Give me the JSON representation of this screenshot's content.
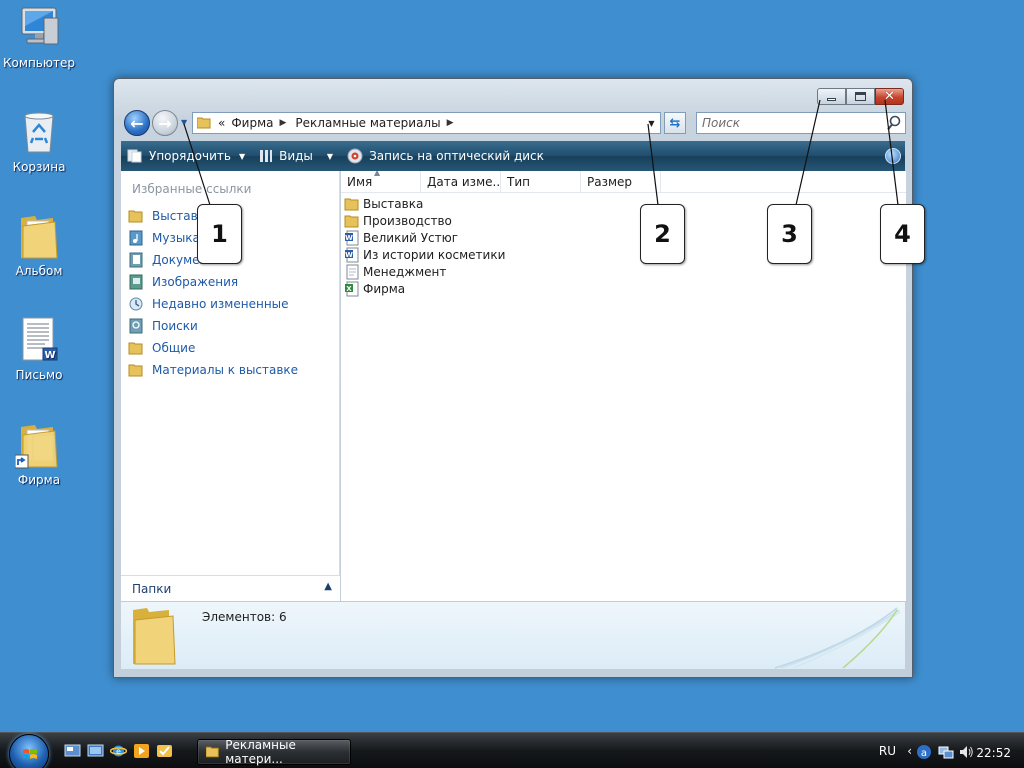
{
  "desktop": {
    "icons": [
      {
        "label": "Компьютер",
        "icon": "computer-icon"
      },
      {
        "label": "Корзина",
        "icon": "recycle-bin-icon"
      },
      {
        "label": "Альбом",
        "icon": "folder-icon"
      },
      {
        "label": "Письмо",
        "icon": "word-document-icon"
      },
      {
        "label": "Фирма",
        "icon": "folder-shortcut-icon"
      }
    ]
  },
  "window": {
    "address": {
      "prefix": "«",
      "segments": [
        "Фирма",
        "Рекламные материалы"
      ]
    },
    "search": {
      "placeholder": "Поиск"
    },
    "toolbar": {
      "organize_label": "Упорядочить",
      "views_label": "Виды",
      "burn_label": "Запись на оптический диск"
    },
    "favorites": {
      "title": "Избранные ссылки",
      "items": [
        {
          "label": "Выставка",
          "icon": "folder-icon"
        },
        {
          "label": "Музыка",
          "icon": "music-icon"
        },
        {
          "label": "Документы",
          "icon": "documents-icon"
        },
        {
          "label": "Изображения",
          "icon": "pictures-icon"
        },
        {
          "label": "Недавно измененные",
          "icon": "recent-icon"
        },
        {
          "label": "Поиски",
          "icon": "searches-icon"
        },
        {
          "label": "Общие",
          "icon": "folder-icon"
        },
        {
          "label": "Материалы к выставке",
          "icon": "folder-icon"
        }
      ]
    },
    "folders_label": "Папки",
    "columns": [
      "Имя",
      "Дата изме...",
      "Тип",
      "Размер"
    ],
    "files": [
      {
        "name": "Выставка",
        "icon": "folder-icon"
      },
      {
        "name": "Производство",
        "icon": "folder-icon"
      },
      {
        "name": "Великий Устюг",
        "icon": "word-document-icon"
      },
      {
        "name": "Из истории косметики",
        "icon": "word-document-icon"
      },
      {
        "name": "Менеджмент",
        "icon": "text-document-icon"
      },
      {
        "name": "Фирма",
        "icon": "excel-document-icon"
      }
    ],
    "details": {
      "count_label": "Элементов: 6"
    }
  },
  "callouts": [
    "1",
    "2",
    "3",
    "4"
  ],
  "taskbar": {
    "task_label": "Рекламные матери...",
    "lang": "RU",
    "clock": "22:52"
  },
  "colors": {
    "desktop": "#3f8fd0",
    "link": "#1e5aa8",
    "command_bar": "#1e4d6d",
    "close_button": "#c8452d"
  }
}
